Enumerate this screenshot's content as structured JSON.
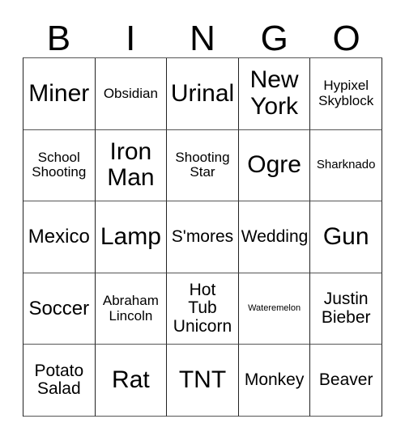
{
  "card": {
    "header_letters": [
      "B",
      "I",
      "N",
      "G",
      "O"
    ],
    "rows": [
      [
        {
          "text": "Miner",
          "size": "fs-xxl"
        },
        {
          "text": "Obsidian",
          "size": "fs-s"
        },
        {
          "text": "Urinal",
          "size": "fs-xxl"
        },
        {
          "text": "New\nYork",
          "size": "fs-xxl"
        },
        {
          "text": "Hypixel\nSkyblock",
          "size": "fs-s"
        }
      ],
      [
        {
          "text": "School\nShooting",
          "size": "fs-s"
        },
        {
          "text": "Iron\nMan",
          "size": "fs-xxl"
        },
        {
          "text": "Shooting\nStar",
          "size": "fs-s"
        },
        {
          "text": "Ogre",
          "size": "fs-xxl"
        },
        {
          "text": "Sharknado",
          "size": "fs-xs"
        }
      ],
      [
        {
          "text": "Mexico",
          "size": "fs-l"
        },
        {
          "text": "Lamp",
          "size": "fs-xxl"
        },
        {
          "text": "S'mores",
          "size": "fs-m"
        },
        {
          "text": "Wedding",
          "size": "fs-m"
        },
        {
          "text": "Gun",
          "size": "fs-xxl"
        }
      ],
      [
        {
          "text": "Soccer",
          "size": "fs-l"
        },
        {
          "text": "Abraham\nLincoln",
          "size": "fs-s"
        },
        {
          "text": "Hot\nTub\nUnicorn",
          "size": "fs-m"
        },
        {
          "text": "Wateremelon",
          "size": "fs-xxs"
        },
        {
          "text": "Justin\nBieber",
          "size": "fs-m"
        }
      ],
      [
        {
          "text": "Potato\nSalad",
          "size": "fs-m"
        },
        {
          "text": "Rat",
          "size": "fs-xxl"
        },
        {
          "text": "TNT",
          "size": "fs-xxl"
        },
        {
          "text": "Monkey",
          "size": "fs-m"
        },
        {
          "text": "Beaver",
          "size": "fs-m"
        }
      ]
    ]
  },
  "colors": {
    "background": "#ffffff",
    "text": "#000000",
    "grid_line": "#222222"
  }
}
